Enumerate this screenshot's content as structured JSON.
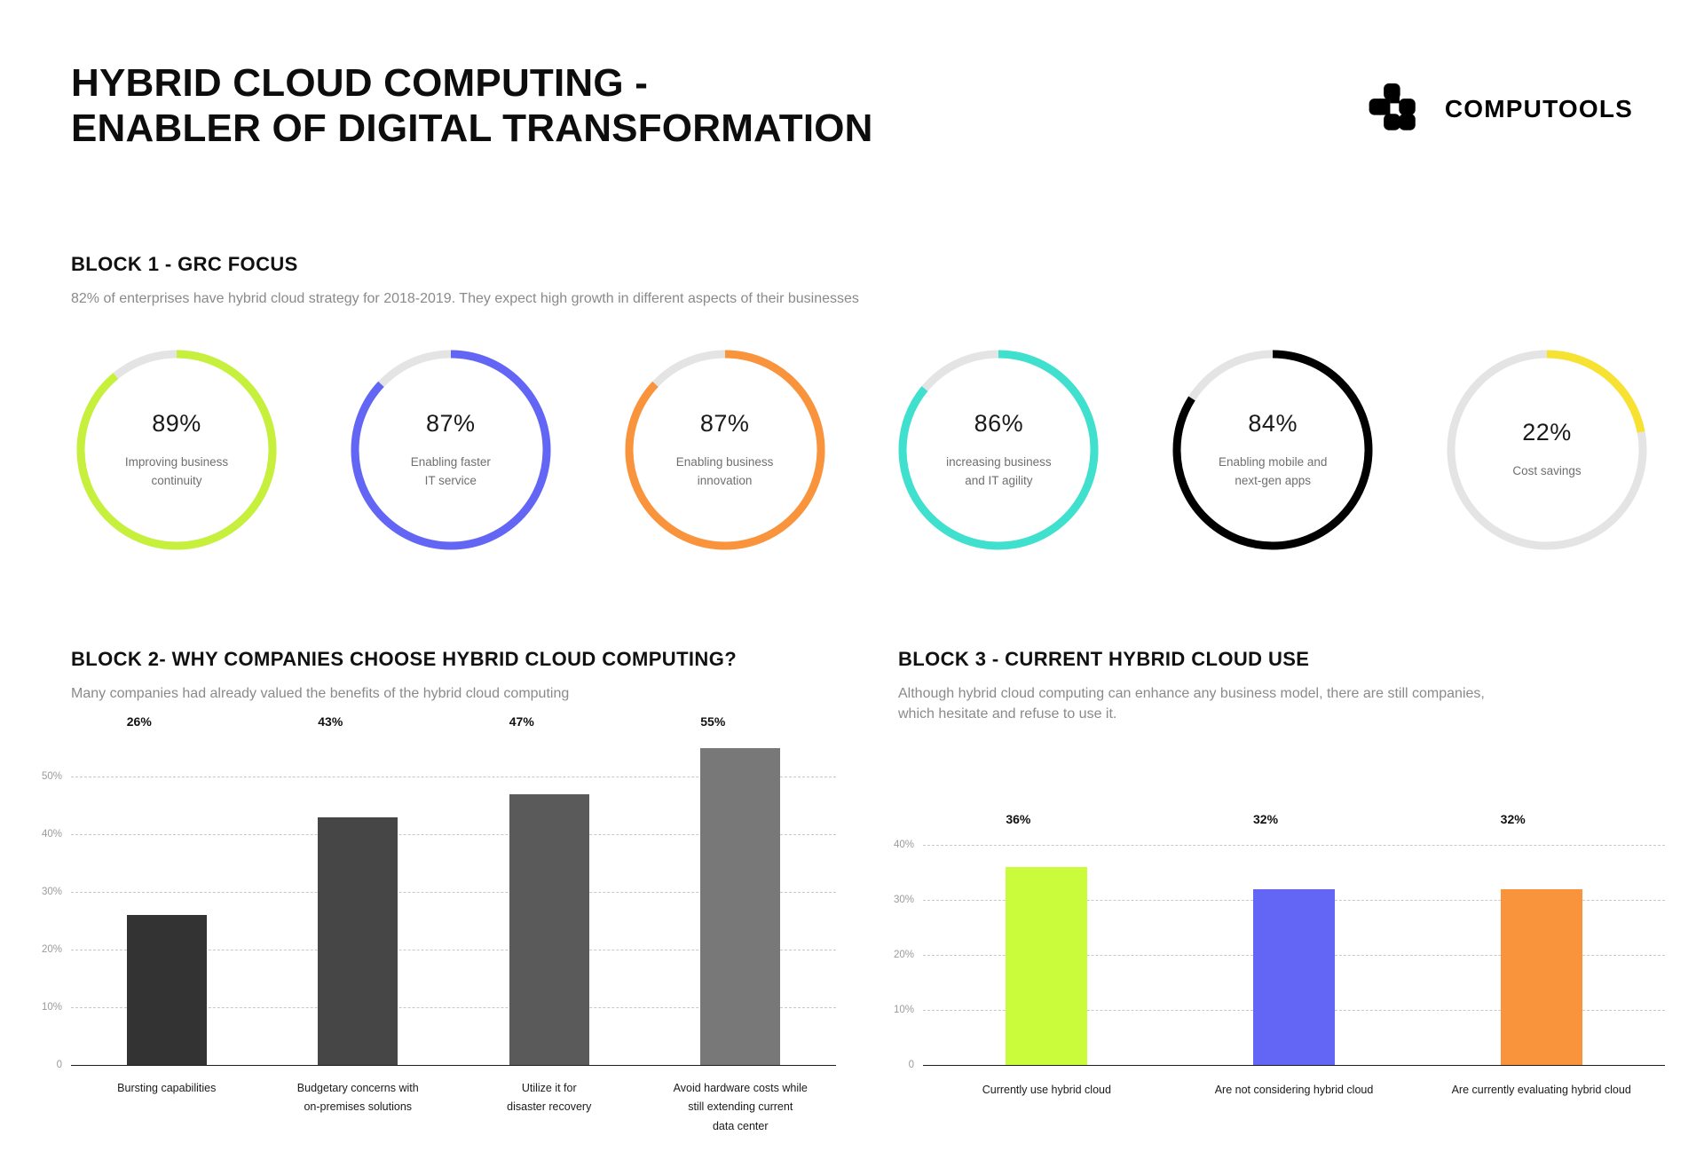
{
  "header": {
    "title": "HYBRID CLOUD COMPUTING -\nENABLER OF DIGITAL TRANSFORMATION",
    "brand_name": "COMPUTOOLS",
    "brand_icon": "computools-logo-icon"
  },
  "block1": {
    "title": "BLOCK 1 - GRC FOCUS",
    "subtitle": "82% of enterprises have hybrid cloud strategy for 2018-2019. They expect high growth in different aspects of their businesses",
    "track_color": "#E4E4E4",
    "donuts": [
      {
        "value": "89%",
        "pct": 89,
        "label": "Improving business\ncontinuity",
        "color": "#C6F03C"
      },
      {
        "value": "87%",
        "pct": 87,
        "label": "Enabling faster\nIT service",
        "color": "#6366F5"
      },
      {
        "value": "87%",
        "pct": 87,
        "label": "Enabling business\ninnovation",
        "color": "#F9943C"
      },
      {
        "value": "86%",
        "pct": 86,
        "label": "increasing business\nand IT agility",
        "color": "#3FE0CD"
      },
      {
        "value": "84%",
        "pct": 84,
        "label": "Enabling mobile and\nnext-gen apps",
        "color": "#000000"
      },
      {
        "value": "22%",
        "pct": 22,
        "label": "Cost savings",
        "color": "#F7E231"
      }
    ]
  },
  "block2": {
    "title": "BLOCK 2- WHY COMPANIES CHOOSE HYBRID CLOUD COMPUTING?",
    "subtitle": "Many companies had already valued the benefits of the hybrid cloud computing"
  },
  "block3": {
    "title": "BLOCK 3 - CURRENT HYBRID CLOUD USE",
    "subtitle": "Although hybrid cloud computing can enhance any business model, there are still companies,\nwhich hesitate and refuse to use it."
  },
  "chart_data": [
    {
      "id": "chart2",
      "type": "bar",
      "title": "BLOCK 2- WHY COMPANIES CHOOSE HYBRID CLOUD COMPUTING?",
      "xlabel": "",
      "ylabel": "",
      "ylim": [
        0,
        57
      ],
      "grid": true,
      "legend": "none",
      "yticks": [
        0,
        10,
        20,
        30,
        40,
        50
      ],
      "ytick_labels": [
        "0",
        "10%",
        "20%",
        "30%",
        "40%",
        "50%"
      ],
      "categories": [
        "Bursting capabilities",
        "Budgetary concerns with\non-premises solutions",
        "Utilize it for\ndisaster recovery",
        "Avoid hardware costs while\nstill extending current\ndata center"
      ],
      "values": [
        26,
        43,
        47,
        55
      ],
      "value_labels": [
        "26%",
        "43%",
        "47%",
        "55%"
      ],
      "colors": [
        "#333333",
        "#464646",
        "#5a5a5a",
        "#787878"
      ]
    },
    {
      "id": "chart3",
      "type": "bar",
      "title": "BLOCK 3 - CURRENT HYBRID CLOUD USE",
      "xlabel": "",
      "ylabel": "",
      "ylim": [
        0,
        42
      ],
      "grid": true,
      "legend": "none",
      "yticks": [
        0,
        10,
        20,
        30,
        40
      ],
      "ytick_labels": [
        "0",
        "10%",
        "20%",
        "30%",
        "40%"
      ],
      "categories": [
        "Currently use hybrid cloud",
        "Are not considering hybrid cloud",
        "Are currently evaluating hybrid cloud"
      ],
      "values": [
        36,
        32,
        32
      ],
      "value_labels": [
        "36%",
        "32%",
        "32%"
      ],
      "colors": [
        "#CAFC3C",
        "#6366F5",
        "#F9943C"
      ]
    }
  ]
}
